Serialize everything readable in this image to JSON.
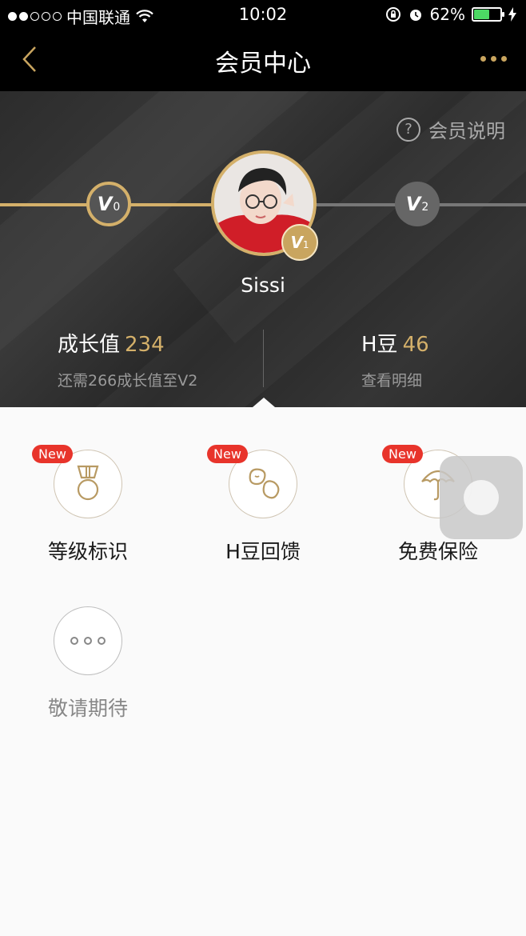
{
  "status_bar": {
    "carrier": "中国联通",
    "time": "10:02",
    "battery_pct": "62%",
    "battery_level": 0.62,
    "signal_bars_filled": 2,
    "signal_bars_total": 5
  },
  "nav": {
    "title": "会员中心",
    "back_icon": "chevron-left-icon",
    "more_icon": "more-dots-icon"
  },
  "header": {
    "help_label": "会员说明",
    "help_icon": "question-circle-icon",
    "levels": [
      {
        "v": "V",
        "n": "0"
      },
      {
        "v": "V",
        "n": "1"
      },
      {
        "v": "V",
        "n": "2"
      }
    ],
    "username": "Sissi",
    "growth": {
      "label": "成长值",
      "value": "234",
      "sub": "还需266成长值至V2"
    },
    "beans": {
      "label": "H豆",
      "value": "46",
      "sub": "查看明细"
    },
    "accent_color": "#d4b06a"
  },
  "features": [
    {
      "label": "等级标识",
      "badge": "New",
      "icon": "medal-icon"
    },
    {
      "label": "H豆回馈",
      "badge": "New",
      "icon": "bean-icon"
    },
    {
      "label": "免费保险",
      "badge": "New",
      "icon": "umbrella-icon"
    },
    {
      "label": "敬请期待",
      "badge": "",
      "icon": "more-dots-icon"
    }
  ]
}
